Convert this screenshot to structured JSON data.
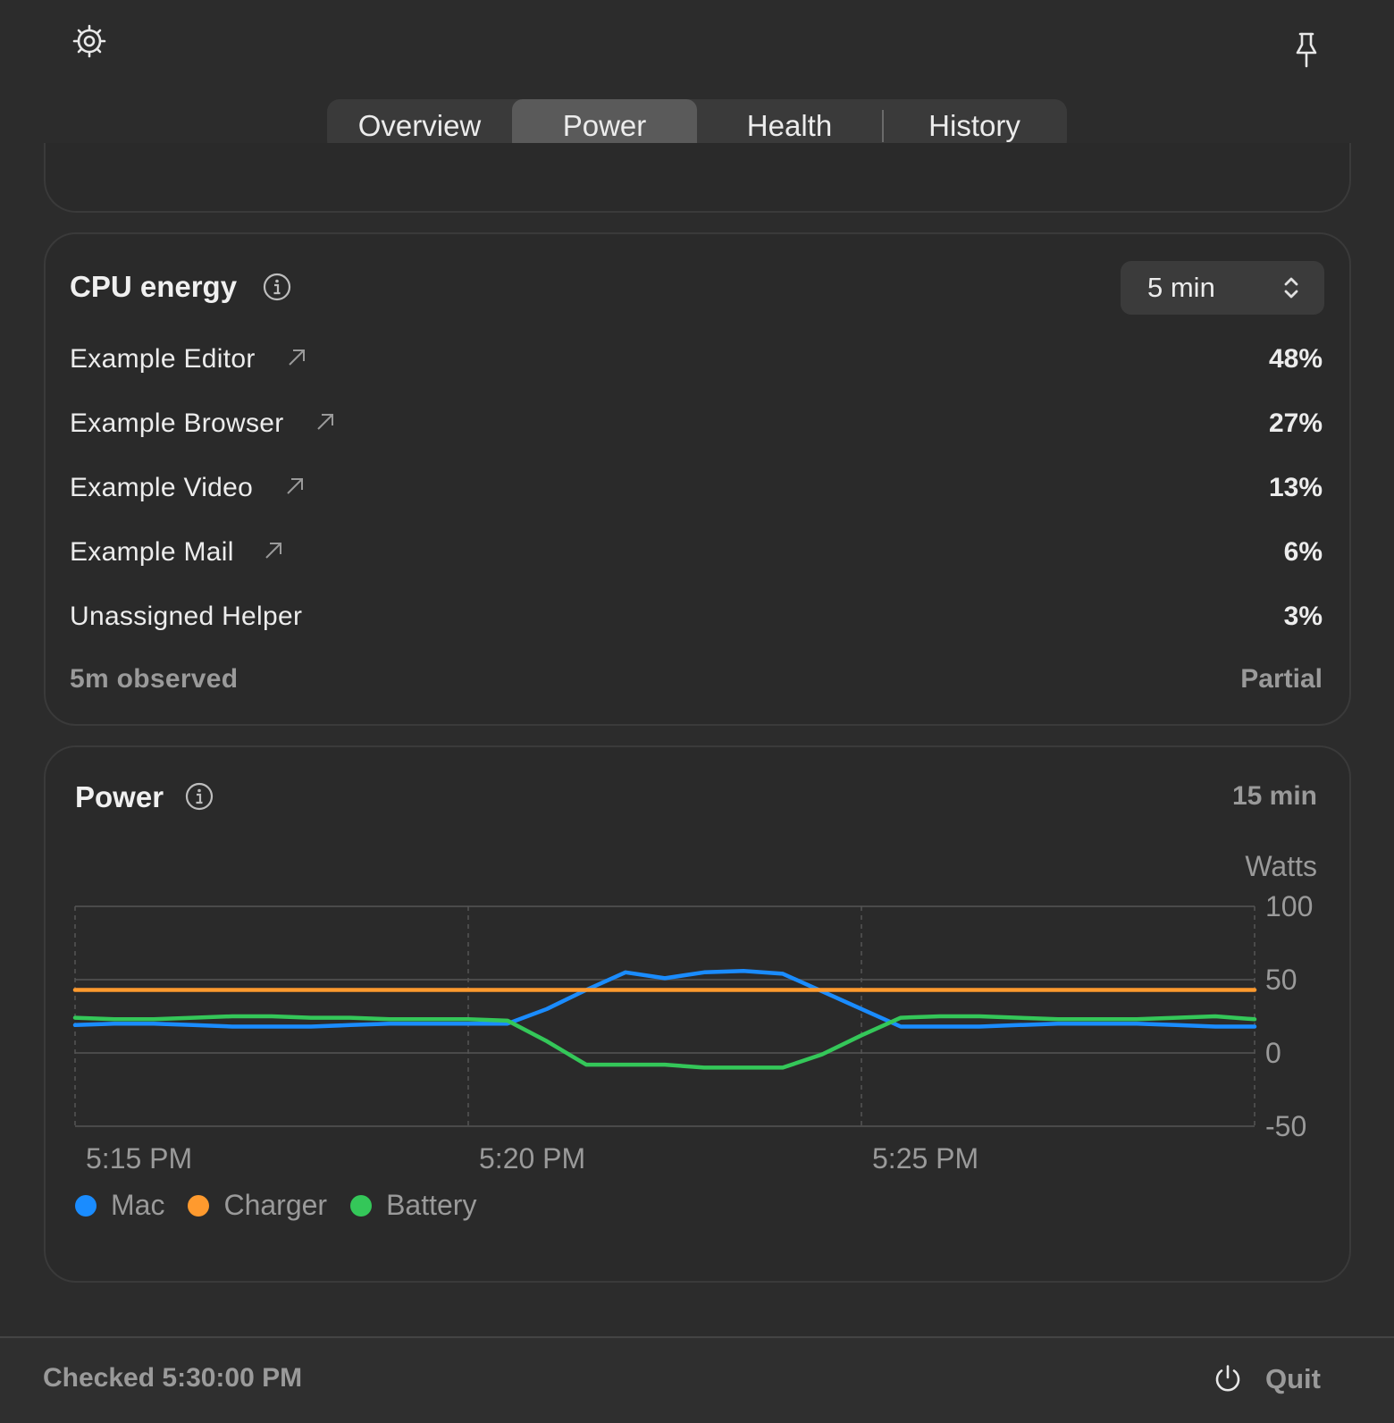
{
  "tabs": [
    {
      "label": "Overview"
    },
    {
      "label": "Power"
    },
    {
      "label": "Health"
    },
    {
      "label": "History"
    }
  ],
  "cpu": {
    "title": "CPU energy",
    "range": "5 min",
    "rows": [
      {
        "name": "Example Editor",
        "value": "48%"
      },
      {
        "name": "Example Browser",
        "value": "27%"
      },
      {
        "name": "Example Video",
        "value": "13%"
      },
      {
        "name": "Example Mail",
        "value": "6%"
      },
      {
        "name": "Unassigned Helper",
        "value": "3%"
      }
    ],
    "footer_left": "5m observed",
    "footer_right": "Partial"
  },
  "power": {
    "title": "Power",
    "range": "15 min",
    "unit": "Watts",
    "legend": [
      {
        "name": "Mac",
        "color": "#1a8cff"
      },
      {
        "name": "Charger",
        "color": "#ff9a2e"
      },
      {
        "name": "Battery",
        "color": "#34c759"
      }
    ]
  },
  "chart_data": {
    "type": "line",
    "ylabel": "Watts",
    "ylim": [
      -50,
      100
    ],
    "yticks": [
      "100",
      "50",
      "0",
      "-50"
    ],
    "xticks": [
      "5:15 PM",
      "5:20 PM",
      "5:25 PM"
    ],
    "x": [
      0,
      0.5,
      1,
      1.5,
      2,
      2.5,
      3,
      3.5,
      4,
      4.5,
      5,
      5.5,
      6,
      6.5,
      7,
      7.5,
      8,
      8.5,
      9,
      9.5,
      10,
      10.5,
      11,
      11.5,
      12,
      12.5,
      13,
      13.5,
      14,
      14.5,
      15
    ],
    "series": [
      {
        "name": "Mac",
        "color": "#1a8cff",
        "values": [
          19,
          20,
          20,
          19,
          18,
          18,
          18,
          19,
          20,
          20,
          20,
          20,
          30,
          43,
          55,
          51,
          55,
          56,
          54,
          42,
          30,
          18,
          18,
          18,
          19,
          20,
          20,
          20,
          19,
          18,
          18
        ]
      },
      {
        "name": "Charger",
        "color": "#ff9a2e",
        "values": [
          43,
          43,
          43,
          43,
          43,
          43,
          43,
          43,
          43,
          43,
          43,
          43,
          43,
          43,
          43,
          43,
          43,
          43,
          43,
          43,
          43,
          43,
          43,
          43,
          43,
          43,
          43,
          43,
          43,
          43,
          43
        ]
      },
      {
        "name": "Battery",
        "color": "#34c759",
        "values": [
          24,
          23,
          23,
          24,
          25,
          25,
          24,
          24,
          23,
          23,
          23,
          22,
          8,
          -8,
          -8,
          -8,
          -10,
          -10,
          -10,
          -1,
          12,
          24,
          25,
          25,
          24,
          23,
          23,
          23,
          24,
          25,
          23
        ]
      }
    ]
  },
  "footer": {
    "status": "Checked 5:30:00 PM",
    "quit": "Quit"
  },
  "icons": {
    "settings": "gear-icon",
    "pin": "pin-icon",
    "info": "info-icon",
    "external": "arrow-up-right-icon",
    "stepper": "chevron-up-down-icon",
    "power": "power-icon"
  }
}
